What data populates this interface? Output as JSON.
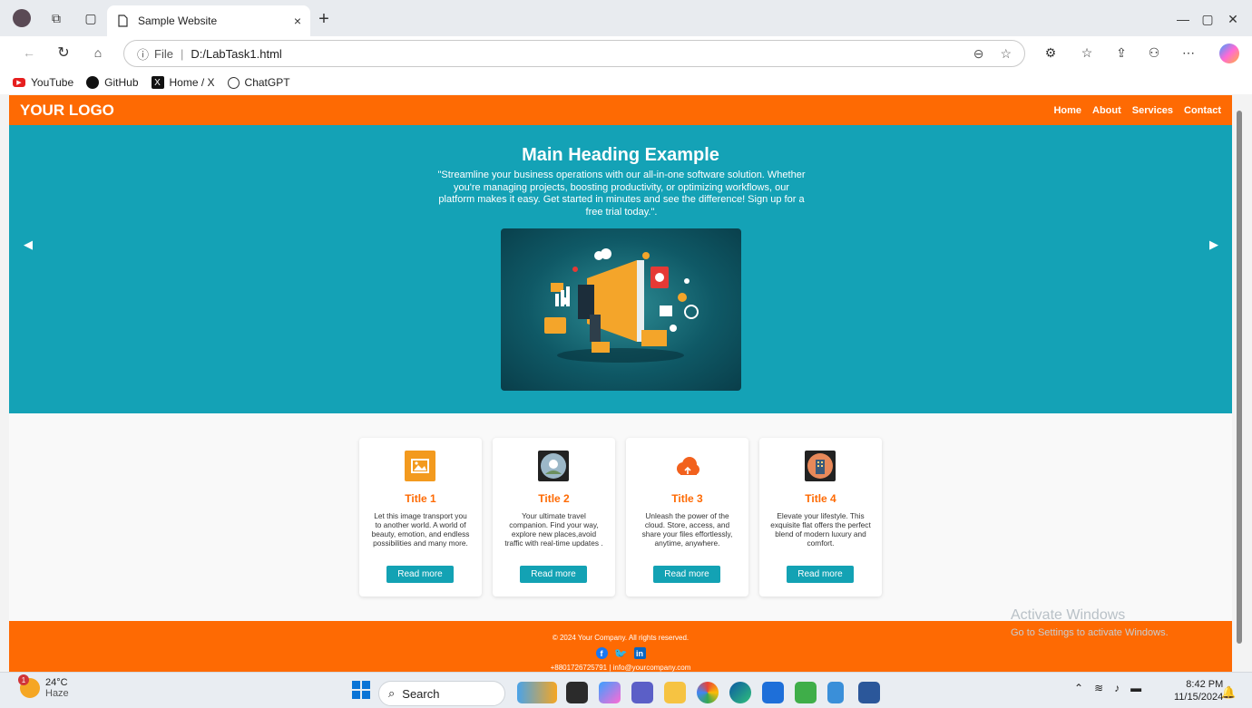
{
  "browser": {
    "tab_title": "Sample Website",
    "tab_close": "×",
    "new_tab": "+",
    "address_info": "ⓘ",
    "address_scheme": "File",
    "address_url": "D:/LabTask1.html",
    "bookmarks": [
      {
        "label": "YouTube",
        "icon": "youtube-icon"
      },
      {
        "label": "GitHub",
        "icon": "github-icon"
      },
      {
        "label": "Home / X",
        "icon": "x-icon"
      },
      {
        "label": "ChatGPT",
        "icon": "chatgpt-icon"
      }
    ]
  },
  "site": {
    "logo": "YOUR LOGO",
    "nav": [
      "Home",
      "About",
      "Services",
      "Contact"
    ],
    "hero": {
      "heading": "Main Heading Example",
      "text": "\"Streamline your business operations with our all-in-one software solution. Whether you're managing projects, boosting productivity, or optimizing workflows, our platform makes it easy. Get started in minutes and see the difference! Sign up for a free trial today.\".",
      "prev": "◀",
      "next": "▶"
    },
    "cards": [
      {
        "title": "Title 1",
        "text": "Let this image transport you to another world. A world of beauty, emotion, and endless possibilities and many more.",
        "button": "Read more",
        "icon": "image-icon"
      },
      {
        "title": "Title 2",
        "text": "Your ultimate travel companion. Find your way, explore new places,avoid traffic with real-time updates .",
        "button": "Read more",
        "icon": "map-pin-icon"
      },
      {
        "title": "Title 3",
        "text": "Unleash the power of the cloud. Store, access, and share your files effortlessly, anytime, anywhere.",
        "button": "Read more",
        "icon": "cloud-upload-icon"
      },
      {
        "title": "Title 4",
        "text": "Elevate your lifestyle. This exquisite flat offers the perfect blend of modern luxury and comfort.",
        "button": "Read more",
        "icon": "building-icon"
      }
    ],
    "footer": {
      "copyright": "© 2024 Your Company. All rights reserved.",
      "social": [
        "facebook-icon",
        "twitter-icon",
        "linkedin-icon"
      ],
      "contact": "+8801726725791 | info@yourcompany.com"
    }
  },
  "os": {
    "watermark_title": "Activate Windows",
    "watermark_sub": "Go to Settings to activate Windows.",
    "weather_temp": "24°C",
    "weather_desc": "Haze",
    "weather_badge": "1",
    "search_placeholder": "Search",
    "time": "8:42 PM",
    "date": "11/15/2024"
  },
  "colors": {
    "brand_orange": "#fe6a03",
    "hero_teal": "#14a2b6",
    "button_teal": "#13a2b4"
  }
}
